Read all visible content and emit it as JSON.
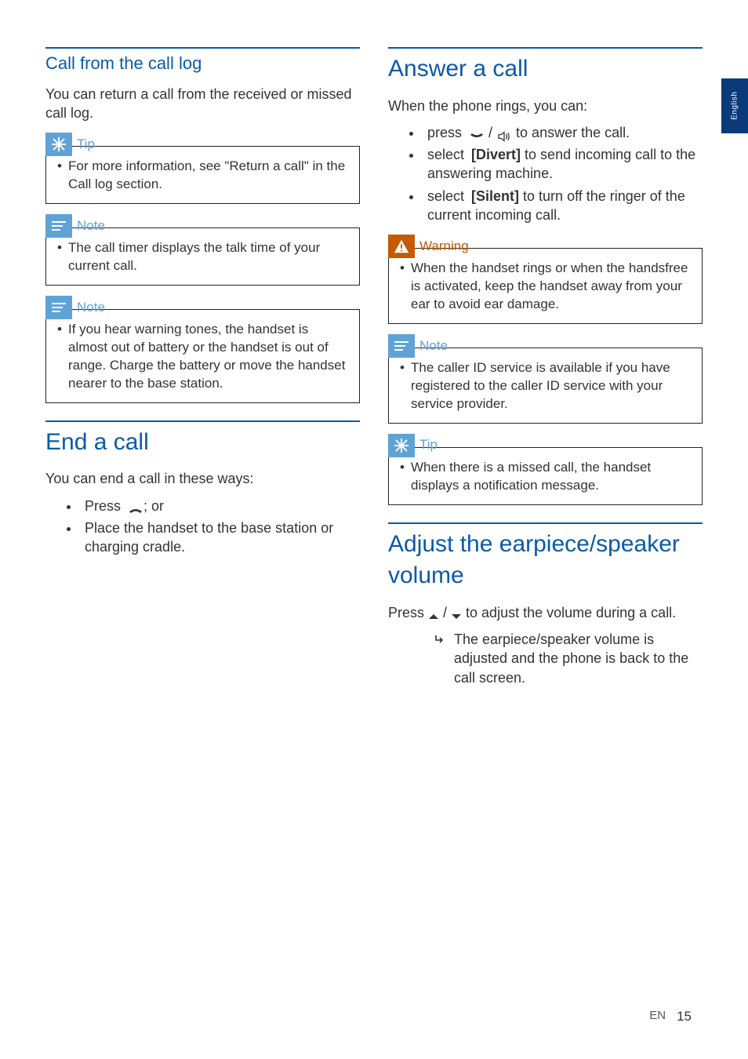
{
  "sideTab": "English",
  "footer": {
    "lang": "EN",
    "page": "15"
  },
  "labels": {
    "tip": "Tip",
    "note": "Note",
    "warning": "Warning"
  },
  "left": {
    "s1": {
      "title": "Call from the call log",
      "intro": "You can return a call from the received or missed call log.",
      "tip": "For more information, see \"Return a call\" in the Call log section.",
      "note1": "The call timer displays the talk time of your current call.",
      "note2": "If you hear warning tones, the handset is almost out of battery or the handset is out of range. Charge the battery or move the handset nearer to the base station."
    },
    "s2": {
      "title": "End a call",
      "intro": "You can end a call in these ways:",
      "b1_pre": "Press ",
      "b1_post": "; or",
      "b2": "Place the handset to the base station or charging cradle."
    }
  },
  "right": {
    "s3": {
      "title": "Answer a call",
      "intro": "When the phone rings, you can:",
      "b1_pre": "press ",
      "b1_mid": " / ",
      "b1_post": " to answer the call.",
      "b2_pre": "select ",
      "b2_bold": "[Divert]",
      "b2_post": " to send incoming call to the answering machine.",
      "b3_pre": "select ",
      "b3_bold": "[Silent]",
      "b3_post": " to turn off the ringer of the current incoming call.",
      "warn": "When the handset rings or when the handsfree is activated, keep the handset away from your ear to avoid ear damage.",
      "note": "The caller ID service is available if you have registered to the caller ID service with your service provider.",
      "tip": "When there is a missed call, the handset displays a notification message."
    },
    "s4": {
      "title": "Adjust the earpiece/speaker volume",
      "p_pre": "Press ",
      "p_mid": " / ",
      "p_post": " to adjust the volume during a call.",
      "result": "The earpiece/speaker volume is adjusted and the phone is back to the call screen."
    }
  }
}
